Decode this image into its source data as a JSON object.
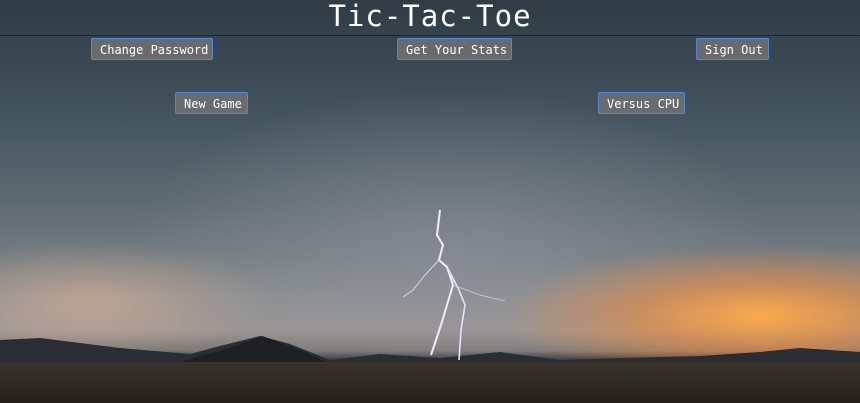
{
  "header": {
    "title": "Tic-Tac-Toe"
  },
  "nav": {
    "change_password": "Change Password",
    "get_stats": "Get Your Stats",
    "sign_out": "Sign Out"
  },
  "game": {
    "new_game": "New Game",
    "versus_cpu": "Versus CPU"
  },
  "background": {
    "scene": "storm-lightning-desert",
    "accent_button_border": "#4f88d8",
    "button_bg": "#6e6e70"
  }
}
